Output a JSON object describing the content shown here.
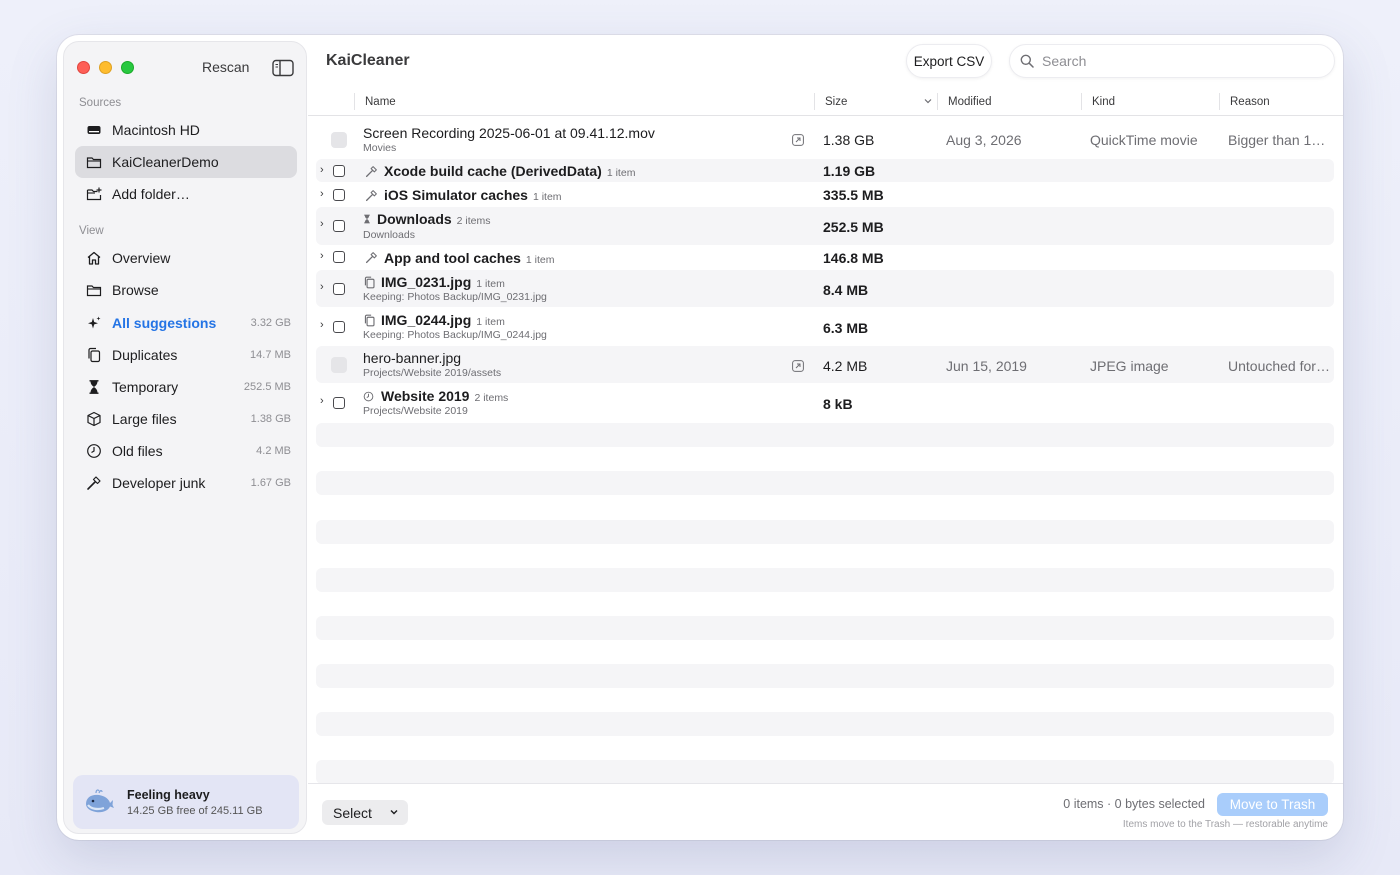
{
  "sidebar": {
    "rescan_label": "Rescan",
    "sources_label": "Sources",
    "sources": [
      {
        "label": "Macintosh HD",
        "icon": "drive-icon"
      },
      {
        "label": "KaiCleanerDemo",
        "icon": "folder-icon"
      },
      {
        "label": "Add folder…",
        "icon": "folder-add-icon"
      }
    ],
    "view_label": "View",
    "views": [
      {
        "label": "Overview",
        "count": "",
        "icon": "home-icon"
      },
      {
        "label": "Browse",
        "count": "",
        "icon": "folder-icon"
      },
      {
        "label": "All suggestions",
        "count": "3.32 GB",
        "icon": "sparkles-icon"
      },
      {
        "label": "Duplicates",
        "count": "14.7 MB",
        "icon": "duplicate-icon"
      },
      {
        "label": "Temporary",
        "count": "252.5 MB",
        "icon": "hourglass-icon"
      },
      {
        "label": "Large files",
        "count": "1.38 GB",
        "icon": "cube-icon"
      },
      {
        "label": "Old files",
        "count": "4.2 MB",
        "icon": "clock-icon"
      },
      {
        "label": "Developer junk",
        "count": "1.67 GB",
        "icon": "hammer-icon"
      }
    ],
    "status": {
      "title": "Feeling heavy",
      "subtitle": "14.25 GB free of 245.11 GB"
    }
  },
  "header": {
    "title": "KaiCleaner",
    "export_label": "Export CSV",
    "search_placeholder": "Search"
  },
  "table": {
    "columns": {
      "name": "Name",
      "size": "Size",
      "modified": "Modified",
      "kind": "Kind",
      "reason": "Reason"
    },
    "rows": [
      {
        "name": "Screen Recording 2025-06-01 at 09.41.12.mov",
        "sub": "Movies",
        "size": "1.38 GB",
        "modified": "Aug 3, 2026",
        "kind": "QuickTime movie",
        "reason": "Bigger than 1…"
      },
      {
        "name": "Xcode build cache (DerivedData)",
        "badge": "1 item",
        "size": "1.19 GB",
        "icon": "hammer-icon"
      },
      {
        "name": "iOS Simulator caches",
        "badge": "1 item",
        "size": "335.5 MB",
        "icon": "hammer-icon"
      },
      {
        "name": "Downloads",
        "badge": "2 items",
        "sub": "Downloads",
        "size": "252.5 MB",
        "icon": "hourglass-icon"
      },
      {
        "name": "App and tool caches",
        "badge": "1 item",
        "size": "146.8 MB",
        "icon": "hammer-icon"
      },
      {
        "name": "IMG_0231.jpg",
        "badge": "1 item",
        "sub": "Keeping: Photos Backup/IMG_0231.jpg",
        "size": "8.4 MB",
        "icon": "duplicate-icon"
      },
      {
        "name": "IMG_0244.jpg",
        "badge": "1 item",
        "sub": "Keeping: Photos Backup/IMG_0244.jpg",
        "size": "6.3 MB",
        "icon": "duplicate-icon"
      },
      {
        "name": "hero-banner.jpg",
        "sub": "Projects/Website 2019/assets",
        "size": "4.2 MB",
        "modified": "Jun 15, 2019",
        "kind": "JPEG image",
        "reason": "Untouched for…"
      },
      {
        "name": "Website 2019",
        "badge": "2 items",
        "sub": "Projects/Website 2019",
        "size": "8 kB",
        "icon": "clock-icon"
      }
    ]
  },
  "footer": {
    "select_label": "Select",
    "selection_status": "0 items · 0 bytes selected",
    "trash_label": "Move to Trash",
    "trash_note": "Items move to the Trash — restorable anytime"
  },
  "colors": {
    "accent": "#2474e5",
    "selected_bg": "#dcdce0",
    "trash_disabled": "#a9cdfb",
    "status_card": "#e3e5f5"
  }
}
